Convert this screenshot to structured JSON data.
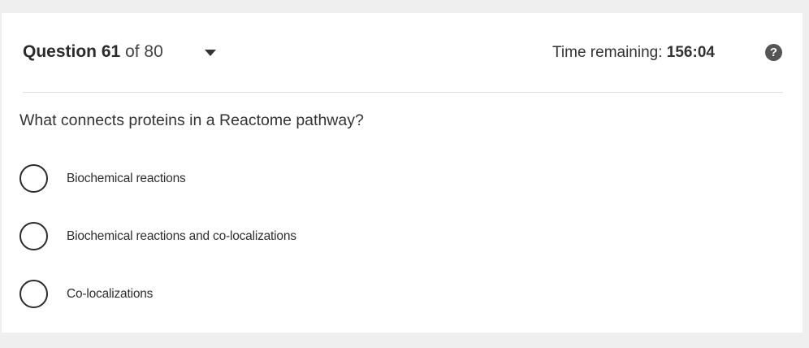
{
  "question": {
    "label": "Question",
    "number": "61",
    "of_text": "of 80",
    "text": "What connects proteins in a Reactome pathway?"
  },
  "timer": {
    "label": "Time remaining:",
    "value": "156:04"
  },
  "help": {
    "glyph": "?",
    "icon": "question-circle-icon"
  },
  "options": [
    {
      "label": "Biochemical reactions",
      "selected": false
    },
    {
      "label": "Biochemical reactions and co-localizations",
      "selected": false
    },
    {
      "label": "Co-localizations",
      "selected": false
    }
  ]
}
